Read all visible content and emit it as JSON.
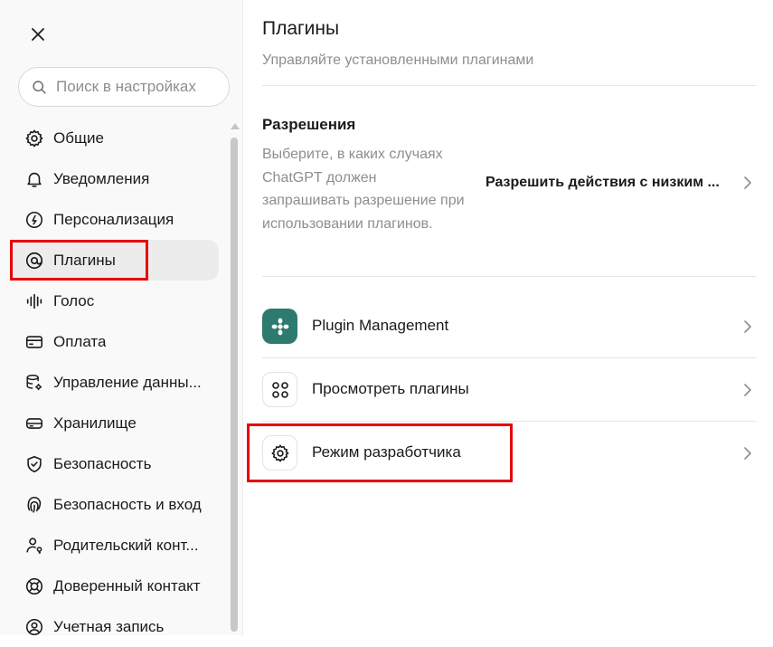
{
  "sidebar": {
    "close_icon": "close-icon",
    "search": {
      "placeholder": "Поиск в настройках",
      "value": ""
    },
    "items": [
      {
        "label": "Общие",
        "icon": "gear-icon"
      },
      {
        "label": "Уведомления",
        "icon": "bell-icon"
      },
      {
        "label": "Персонализация",
        "icon": "personalization-icon"
      },
      {
        "label": "Плагины",
        "icon": "plugins-icon",
        "active": true
      },
      {
        "label": "Голос",
        "icon": "voice-icon"
      },
      {
        "label": "Оплата",
        "icon": "card-icon"
      },
      {
        "label": "Управление данны...",
        "icon": "database-gear-icon"
      },
      {
        "label": "Хранилище",
        "icon": "storage-icon"
      },
      {
        "label": "Безопасность",
        "icon": "shield-icon"
      },
      {
        "label": "Безопасность и вход",
        "icon": "fingerprint-icon"
      },
      {
        "label": "Родительский конт...",
        "icon": "parental-icon"
      },
      {
        "label": "Доверенный контакт",
        "icon": "lifebuoy-icon"
      },
      {
        "label": "Учетная запись",
        "icon": "account-icon"
      }
    ]
  },
  "main": {
    "title": "Плагины",
    "subtitle": "Управляйте установленными плагинами",
    "permissions": {
      "title": "Разрешения",
      "description": "Выберите, в каких случаях ChatGPT должен запрашивать разрешение при использовании плагинов.",
      "value": "Разрешить действия с низким ..."
    },
    "rows": [
      {
        "label": "Plugin Management",
        "icon": "plugin-management-icon"
      },
      {
        "label": "Просмотреть плагины",
        "icon": "grid-dots-icon"
      },
      {
        "label": "Режим разработчика",
        "icon": "gear-icon"
      }
    ]
  },
  "colors": {
    "highlight": "#e8000b",
    "plugin_tile": "#2d7a6e",
    "active_bg": "#ececec"
  }
}
